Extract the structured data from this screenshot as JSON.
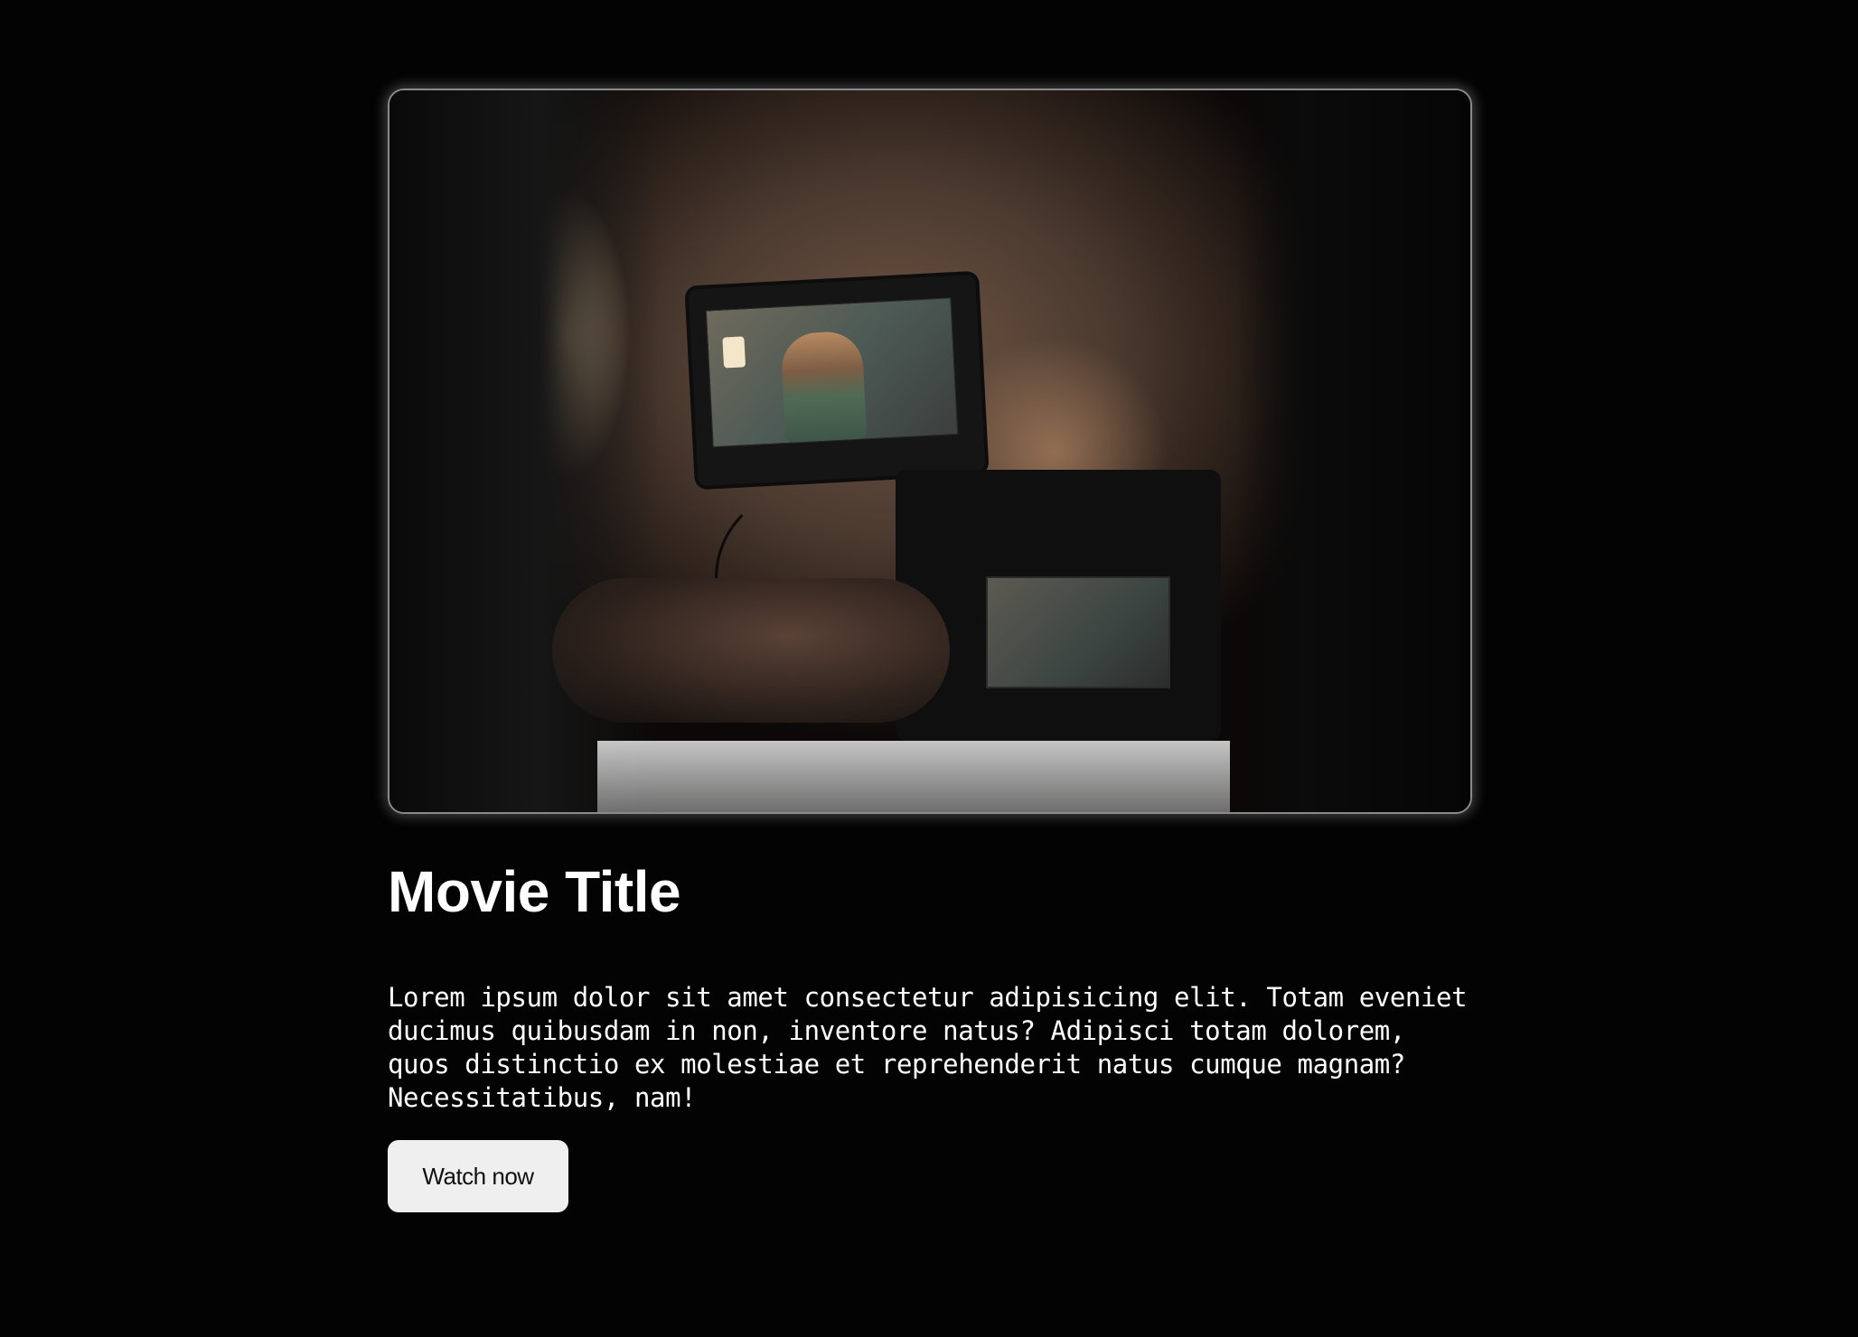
{
  "hero": {
    "image_subject": "film-crew-camera-scene"
  },
  "movie": {
    "title": "Movie Title",
    "description": "Lorem ipsum dolor sit amet consectetur adipisicing elit. Totam eveniet ducimus quibusdam in non, inventore natus? Adipisci totam dolorem, quos distinctio ex molestiae et reprehenderit natus cumque magnam? Necessitatibus, nam!",
    "watch_label": "Watch now"
  },
  "colors": {
    "background": "#030303",
    "text": "#ffffff",
    "button_bg": "#efefef",
    "button_text": "#111111",
    "image_border": "#8a8a8a"
  }
}
